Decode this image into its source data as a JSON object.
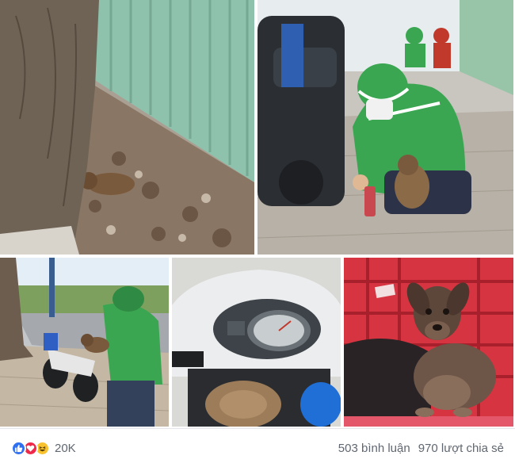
{
  "post": {
    "photos": [
      {
        "name": "photo-puppy-by-tree",
        "alt": "Puppy lying among dry leaves next to a tree and metal fence"
      },
      {
        "name": "photo-driver-feeding-puppy",
        "alt": "Driver in green jacket and helmet feeding a puppy beside a motorbike"
      },
      {
        "name": "photo-driver-holding-puppy",
        "alt": "Driver holding puppy next to a parked motorbike on the street"
      },
      {
        "name": "photo-puppy-in-scooter",
        "alt": "Puppy riding in the front compartment of a scooter"
      },
      {
        "name": "photo-puppy-in-basket",
        "alt": "Puppy sitting in a red plastic basket"
      }
    ],
    "reactions": {
      "icons": [
        "like-icon",
        "love-icon",
        "haha-icon"
      ],
      "count": "20K"
    },
    "comments_label": "503 bình luận",
    "shares_label": "970 lượt chia sẻ",
    "colors": {
      "like": "#2f6ff1",
      "love": "#f0284a",
      "haha": "#f7c22d",
      "driver_green": "#3aa651",
      "text_muted": "#606770"
    }
  }
}
